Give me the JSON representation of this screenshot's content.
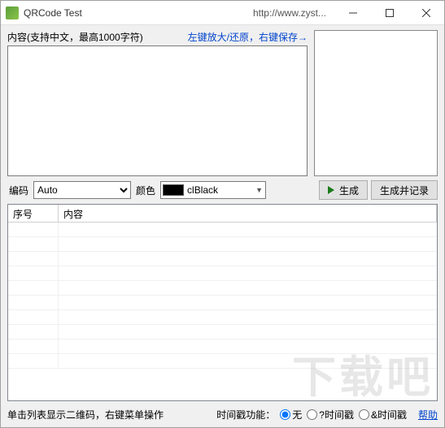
{
  "titlebar": {
    "title": "QRCode Test",
    "url": "http://www.zyst..."
  },
  "labels": {
    "content_label": "内容(支持中文，最高1000字符)",
    "zoom_hint": "左键放大/还原，右键保存→",
    "encoding_label": "编码",
    "color_label": "颜色",
    "list_hint": "单击列表显示二维码，右键菜单操作",
    "timestamp_label": "时间戳功能："
  },
  "encoding": {
    "selected": "Auto",
    "options": [
      "Auto"
    ]
  },
  "color": {
    "selected": "clBlack"
  },
  "buttons": {
    "generate": "生成",
    "generate_record": "生成并记录"
  },
  "table": {
    "col_seq": "序号",
    "col_content": "内容"
  },
  "radios": {
    "none": "无",
    "qmark": "?时间戳",
    "amp": "&时间戳"
  },
  "help": "帮助",
  "watermark": "下载吧"
}
